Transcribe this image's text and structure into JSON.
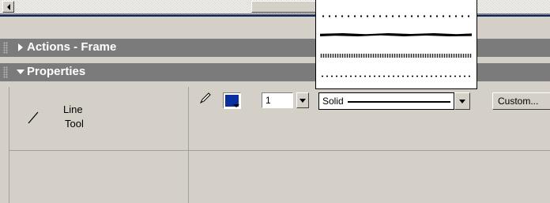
{
  "panels": {
    "actions": {
      "title": "Actions - Frame",
      "state": "collapsed"
    },
    "properties": {
      "title": "Properties",
      "state": "expanded"
    }
  },
  "properties": {
    "tool_name_line1": "Line",
    "tool_name_line2": "Tool",
    "stroke_color": "#0a2fa0",
    "stroke_width": "1",
    "stroke_style": "Solid",
    "custom_button": "Custom..."
  },
  "stroke_style_list": [
    "dotted",
    "ragged",
    "stipple",
    "hatched"
  ],
  "icons": [
    "scroll-left-arrow-icon",
    "panel-grip-icon",
    "collapsed-triangle-icon",
    "expanded-triangle-icon",
    "line-tool-icon",
    "pencil-icon",
    "dropdown-arrow-icon"
  ]
}
